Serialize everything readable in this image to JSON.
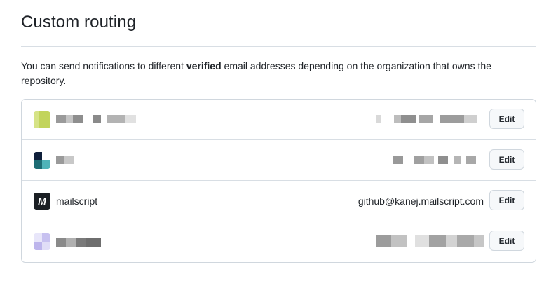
{
  "page": {
    "title": "Custom routing",
    "description_prefix": "You can send notifications to different ",
    "description_bold": "verified",
    "description_suffix": " email addresses depending on the organization that owns the repository."
  },
  "routes": [
    {
      "org": "",
      "email": "",
      "redacted": true,
      "avatar": "lime-org-avatar",
      "edit_label": "Edit"
    },
    {
      "org": "",
      "email": "",
      "redacted": true,
      "avatar": "teal-org-avatar",
      "edit_label": "Edit"
    },
    {
      "org": "mailscript",
      "email": "github@kanej.mailscript.com",
      "redacted": false,
      "avatar": "mailscript-logo",
      "avatar_glyph": "M",
      "edit_label": "Edit"
    },
    {
      "org": "",
      "email": "",
      "redacted": true,
      "avatar": "lavender-org-avatar",
      "edit_label": "Edit"
    }
  ],
  "colors": {
    "text": "#1f2328",
    "border": "#d0d7de",
    "button_bg": "#f6f8fa"
  }
}
